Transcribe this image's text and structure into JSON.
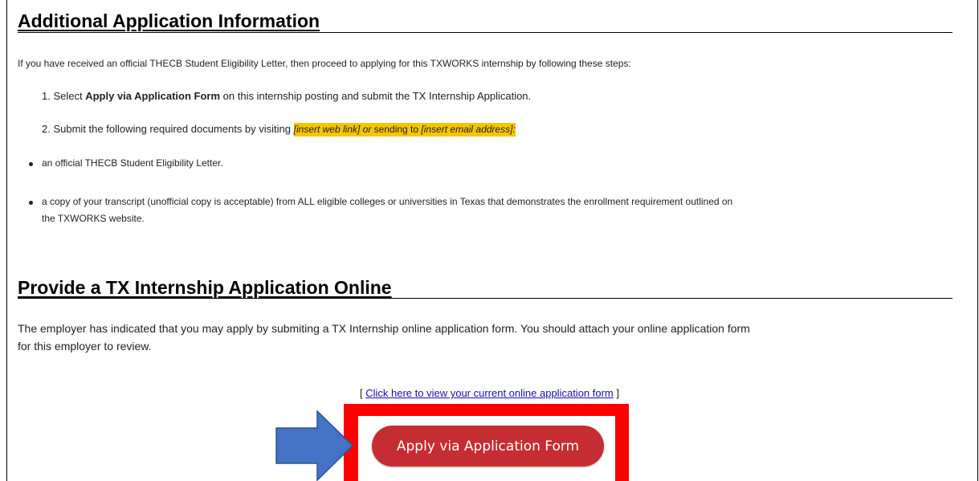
{
  "section1": {
    "title": "Additional Application Information",
    "intro": "If you have received an official THECB Student Eligibility Letter, then proceed to applying for this TXWORKS internship by following these steps:",
    "step1": {
      "number": "1.",
      "prefix": "Select ",
      "bold": "Apply via Application Form",
      "suffix": " on this internship posting and submit the TX Internship Application."
    },
    "step2": {
      "number": "2.",
      "prefix": "Submit the following required documents by visiting ",
      "link_placeholder": "[insert web link]",
      "or_text": " or ",
      "sending_text": "sending to ",
      "email_placeholder": "[insert email address]",
      "colon": ":"
    },
    "bullets": [
      "an official THECB Student Eligibility  Letter.",
      "a copy of your transcript (unofficial copy is acceptable) from ALL eligible colleges or universities in Texas that demonstrates the enrollment requirement outlined on",
      "the TXWORKS website."
    ]
  },
  "section2": {
    "title": "Provide a TX Internship Application Online",
    "para_line1": "The employer has indicated that you may apply by submiting a TX Internship online application form. You should attach your online application form",
    "para_line2": "for this employer to review.",
    "link_open": "[ ",
    "link_text": "Click here to view your current online application form",
    "link_close": " ]",
    "apply_button": "Apply via Application Form"
  },
  "colors": {
    "highlight": "#f7c500",
    "button": "#c62d32",
    "annotation_box": "#ff0000",
    "annotation_arrow": "#4472c4",
    "link": "#1a0dab"
  },
  "icons": {
    "arrow": "arrow-right-icon"
  }
}
